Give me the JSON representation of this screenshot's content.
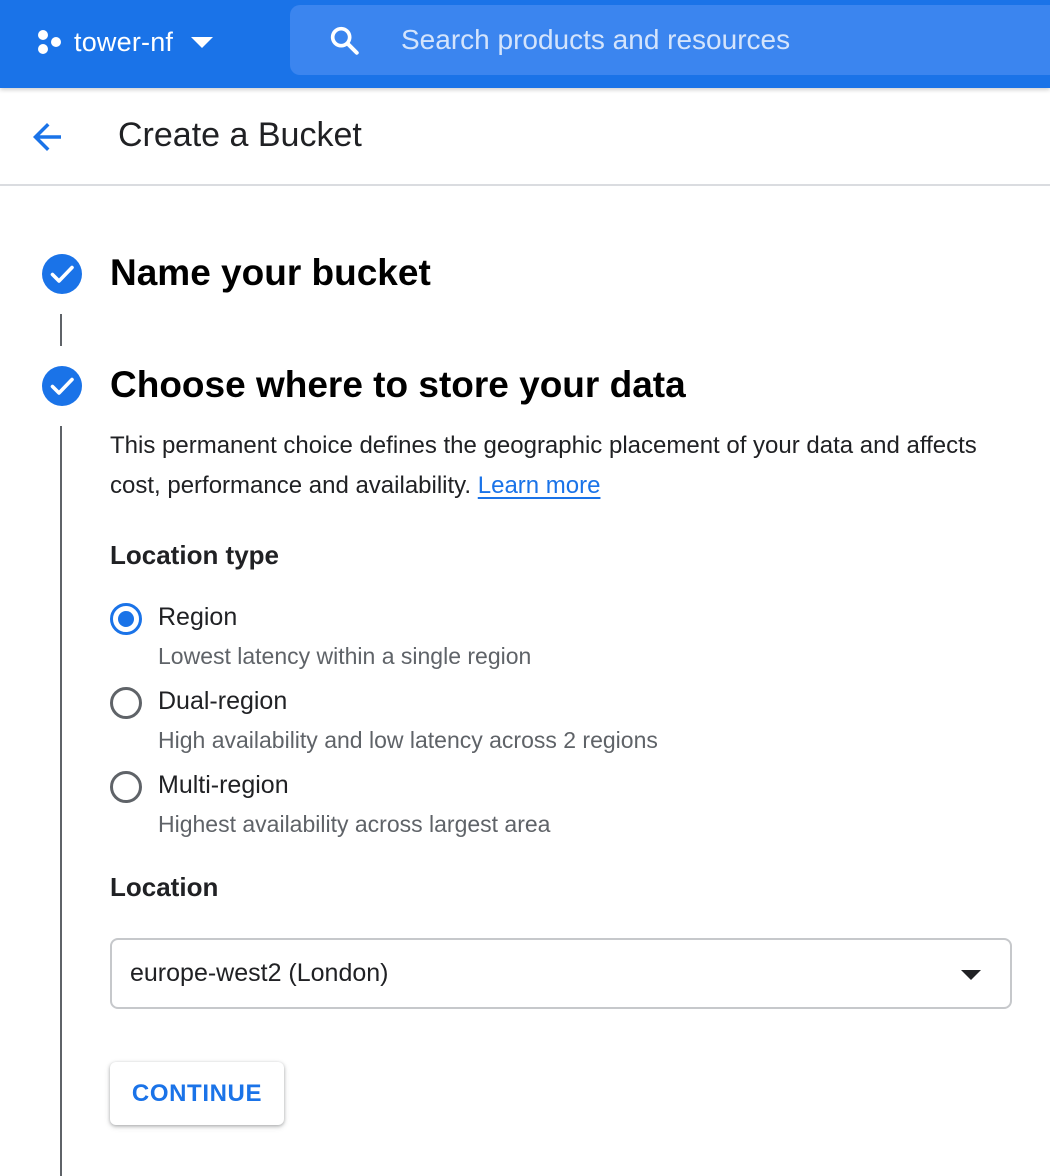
{
  "topbar": {
    "project_name": "tower-nf",
    "search_placeholder": "Search products and resources",
    "background_color": "#1a73e8",
    "icons": {
      "project": "project-hexagon-dots-icon",
      "dropdown": "caret-down-icon",
      "search": "search-icon"
    }
  },
  "header": {
    "title": "Create a Bucket",
    "back_icon": "arrow-left-icon"
  },
  "steps": [
    {
      "title": "Name your bucket",
      "status": "complete",
      "icon": "check-circle-icon"
    },
    {
      "title": "Choose where to store your data",
      "status": "complete",
      "icon": "check-circle-icon"
    }
  ],
  "location_step": {
    "description": "This permanent choice defines the geographic placement of your data and affects cost, performance and availability.",
    "learn_more": "Learn more",
    "location_type_label": "Location type",
    "options": [
      {
        "label": "Region",
        "description": "Lowest latency within a single region",
        "selected": true
      },
      {
        "label": "Dual-region",
        "description": "High availability and low latency across 2 regions",
        "selected": false
      },
      {
        "label": "Multi-region",
        "description": "Highest availability across largest area",
        "selected": false
      }
    ],
    "location_label": "Location",
    "location_value": "europe-west2 (London)",
    "continue_label": "CONTINUE"
  },
  "colors": {
    "accent": "#1a73e8",
    "text_primary": "#202124",
    "text_secondary": "#5f6368"
  }
}
